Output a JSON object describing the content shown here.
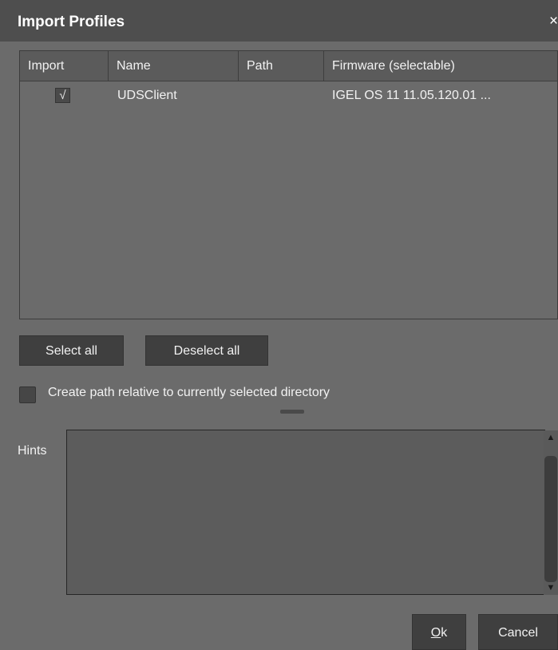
{
  "dialog": {
    "title": "Import Profiles",
    "close_glyph": "×"
  },
  "table": {
    "columns": [
      "Import",
      "Name",
      "Path",
      "Firmware (selectable)"
    ],
    "rows": [
      {
        "import_checked": true,
        "check_glyph": "√",
        "name": "UDSClient",
        "path": "",
        "firmware": "IGEL OS 11 11.05.120.01 ..."
      }
    ]
  },
  "buttons": {
    "select_all": "Select all",
    "deselect_all": "Deselect all",
    "ok_mnemonic": "O",
    "ok_rest": "k",
    "cancel": "Cancel"
  },
  "option": {
    "relative_path_label": "Create path relative to currently selected directory",
    "relative_path_checked": false
  },
  "hints": {
    "label": "Hints",
    "text": ""
  },
  "icons": {
    "close": "close-icon",
    "scroll_up": "arrow-up-icon",
    "scroll_down": "arrow-down-icon"
  },
  "colors": {
    "background": "#6b6b6b",
    "titlebar": "#4e4e4e",
    "button": "#3f3f3f"
  }
}
